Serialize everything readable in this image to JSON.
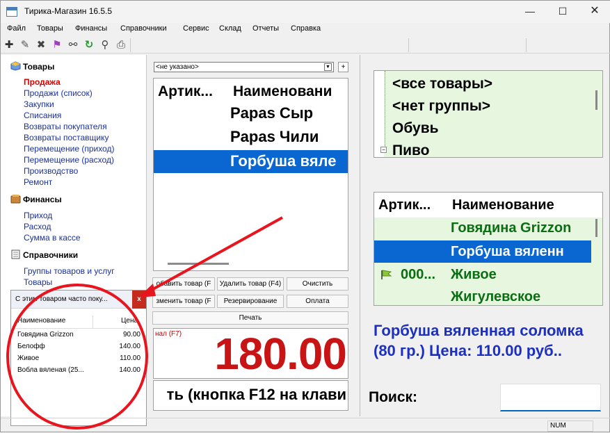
{
  "window": {
    "title": "Тирика-Магазин 16.5.5",
    "minimize": "—",
    "maximize": "☐",
    "close": "✕"
  },
  "menu": [
    "Файл",
    "Товары",
    "Финансы",
    "Справочники",
    "Сервис",
    "Склад",
    "Отчеты",
    "Справка"
  ],
  "sidebar": {
    "goods_header": "Товары",
    "goods_links": [
      "Продажа",
      "Продажи (список)",
      "Закупки",
      "Списания",
      "Возвраты покупателя",
      "Возвраты поставщику",
      "Перемещение (приход)",
      "Перемещение (расход)",
      "Производство",
      "Ремонт"
    ],
    "finance_header": "Финансы",
    "finance_links": [
      "Приход",
      "Расход",
      "Сумма в кассе"
    ],
    "refs_header": "Справочники",
    "refs_links": [
      "Группы товаров и услуг",
      "Товары"
    ]
  },
  "sale": {
    "customer_select": "<не указано>",
    "add_button": "+",
    "col_article": "Артик...",
    "col_name": "Наименовани",
    "rows": [
      "Papas Сыр",
      "Papas Чили",
      "Горбуша вяле"
    ],
    "buttons": {
      "add": "обавить товар (F",
      "delete": "Удалить товар (F4)",
      "clear": "Очистить",
      "change": "зменить товар (F",
      "reserve": "Резервирование",
      "pay": "Оплата",
      "print": "Печать"
    },
    "total_caption": "нал (F7)",
    "total": "180.00",
    "pay_hint": "ть (кнопка F12 на клави"
  },
  "tree": {
    "items": [
      "<все товары>",
      "<нет группы>",
      "Обувь",
      "Пиво"
    ],
    "collapse": "−"
  },
  "products": {
    "col_article": "Артик...",
    "col_name": "Наименование",
    "rows": [
      {
        "article": "",
        "name": "Говядина Grizzon"
      },
      {
        "article": "",
        "name": "Горбуша вяленн"
      },
      {
        "article": "000...",
        "name": "Живое"
      },
      {
        "article": "",
        "name": "Жигулевское"
      }
    ],
    "description": "Горбуша вяленная соломка (80 гр.) Цена: 110.00 руб.."
  },
  "search": {
    "label": "Поиск:",
    "value": ""
  },
  "popup": {
    "title": "С этим товаром часто поку...",
    "close": "x",
    "col_name": "Наименование",
    "col_price": "Цена",
    "rows": [
      {
        "name": "Говядина Grizzon",
        "price": "90.00"
      },
      {
        "name": "Белофф",
        "price": "140.00"
      },
      {
        "name": "Живое",
        "price": "110.00"
      },
      {
        "name": "Вобла вяленая (25...",
        "price": "140.00"
      }
    ]
  },
  "status": {
    "num": "NUM"
  },
  "colors": {
    "active_link": "#e00000",
    "link": "#1a2f9c",
    "selection": "#0a67d1",
    "total": "#c81414",
    "green_text": "#0a6e12",
    "desc_text": "#1c2fbf",
    "annotation": "#e8141e"
  }
}
